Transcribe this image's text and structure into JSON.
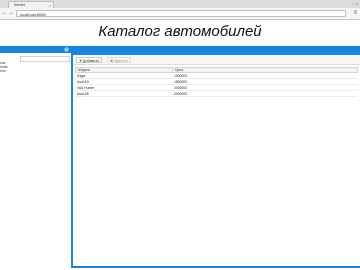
{
  "browser": {
    "tab_title": "Servlet",
    "url": "localhost:8080",
    "tab_close": "×",
    "window_controls": "– ×",
    "back_icon": "←",
    "forward_icon": "→",
    "menu_icon": "≡"
  },
  "page": {
    "title": "Каталог автомобилей"
  },
  "left_panel": {
    "header_label": "",
    "tree_items": [
      {
        "label": "сси"
      },
      {
        "label": "ения"
      },
      {
        "label": "нчи"
      }
    ]
  },
  "toolbar": {
    "add_label": "Добавить",
    "delete_label": "Удалить"
  },
  "grid": {
    "columns": [
      "Модель",
      "Цена"
    ],
    "rows": [
      {
        "model": "Лада",
        "price": "1300000"
      },
      {
        "model": "Audi A3",
        "price": "1800000"
      },
      {
        "model": "УАЗ Hunter",
        "price": "2000000"
      },
      {
        "model": "Audi A5",
        "price": "2000000"
      }
    ]
  },
  "colors": {
    "accent": "#1a84d8",
    "header_bg": "#f2f2f2"
  }
}
